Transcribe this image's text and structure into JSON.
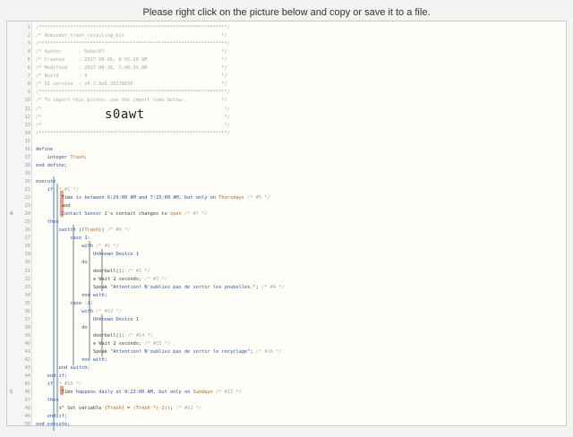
{
  "banner": "Please right click on the picture below and copy or save it to a file.",
  "import_code": "s0awt",
  "lines": [
    {
      "n": "1",
      "t": [
        [
          "/******************************************************************/",
          "cm"
        ]
      ]
    },
    {
      "n": "2",
      "t": [
        [
          "/* Reminder_trash_recycling_bin                                  */",
          "cm"
        ]
      ]
    },
    {
      "n": "3",
      "t": [
        [
          "/******************************************************************/",
          "cm"
        ]
      ]
    },
    {
      "n": "4",
      "t": [
        [
          "/* Author      : Rebel87                                         */",
          "cm"
        ]
      ]
    },
    {
      "n": "5",
      "t": [
        [
          "/* Created     : 2017-08-06, 8:56:28 AM                          */",
          "cm"
        ]
      ]
    },
    {
      "n": "6",
      "t": [
        [
          "/* Modified    : 2017-08-16, 7:48:31 AM                          */",
          "cm"
        ]
      ]
    },
    {
      "n": "7",
      "t": [
        [
          "/* Build       : 9                                               */",
          "cm"
        ]
      ]
    },
    {
      "n": "8",
      "t": [
        [
          "/* UI version  : v0.2.0e6.20170830                               */",
          "cm"
        ]
      ]
    },
    {
      "n": "9",
      "t": [
        [
          "/******************************************************************/",
          "cm"
        ]
      ]
    },
    {
      "n": "10",
      "t": [
        [
          "/* To import this piston, use the import code below:             */",
          "cm"
        ]
      ]
    },
    {
      "n": "11",
      "t": [
        [
          "/*                                                                */",
          "cm"
        ]
      ]
    },
    {
      "n": "12",
      "t": [
        [
          "/*                                                                */",
          "cm"
        ]
      ]
    },
    {
      "n": "13",
      "t": [
        [
          "/*                                                                */",
          "cm"
        ]
      ]
    },
    {
      "n": "14",
      "t": [
        [
          "/******************************************************************/",
          "cm"
        ]
      ]
    },
    {
      "n": "15",
      "t": []
    },
    {
      "n": "16",
      "t": [
        [
          "define",
          "kw"
        ]
      ]
    },
    {
      "n": "17",
      "i": 4,
      "t": [
        [
          "integer ",
          "kw"
        ],
        [
          "Trash",
          "vr"
        ],
        [
          ";",
          ""
        ]
      ]
    },
    {
      "n": "18",
      "t": [
        [
          "end define;",
          "kw"
        ]
      ]
    },
    {
      "n": "19",
      "t": []
    },
    {
      "n": "20",
      "t": [
        [
          "execute",
          "kw"
        ]
      ]
    },
    {
      "n": "21",
      "i": 4,
      "t": [
        [
          "if ",
          "kw"
        ],
        [
          "/* #1 */",
          "cm"
        ]
      ]
    },
    {
      "n": "22",
      "i": 9,
      "t": [
        [
          "Time",
          ""
        ],
        [
          " is between ",
          "kw"
        ],
        [
          "6:29:00 AM",
          "num"
        ],
        [
          " and ",
          "kw"
        ],
        [
          "7:15:00 AM",
          "num"
        ],
        [
          ", but only on ",
          "kw"
        ],
        [
          "Thursdays",
          "vr"
        ],
        [
          " /* #5 */",
          "cm"
        ]
      ]
    },
    {
      "n": "23",
      "i": 9,
      "t": [
        [
          "and",
          ""
        ]
      ]
    },
    {
      "n": "24",
      "m": "4",
      "i": 9,
      "t": [
        [
          "Contact Sensor 2",
          "dev"
        ],
        [
          "'s contact changes to ",
          ""
        ],
        [
          "open",
          "vr"
        ],
        [
          " /* #7 */",
          "cm"
        ]
      ]
    },
    {
      "n": "25",
      "i": 4,
      "t": [
        [
          "then",
          "kw"
        ]
      ]
    },
    {
      "n": "26",
      "i": 8,
      "t": [
        [
          "switch",
          "kw"
        ],
        [
          " ((",
          ""
        ],
        [
          "Trash",
          "vr"
        ],
        [
          ")) ",
          ""
        ],
        [
          "/* #9 */",
          "cm"
        ]
      ]
    },
    {
      "n": "27",
      "i": 12,
      "t": [
        [
          "case 1:",
          "kw"
        ]
      ]
    },
    {
      "n": "28",
      "i": 16,
      "t": [
        [
          "with",
          "kw"
        ],
        [
          " /* #1 */",
          "cm"
        ]
      ]
    },
    {
      "n": "29",
      "i": 20,
      "t": [
        [
          "Unknown Device 1",
          "dev"
        ]
      ]
    },
    {
      "n": "30",
      "i": 16,
      "t": [
        [
          "do",
          "kw"
        ]
      ]
    },
    {
      "n": "31",
      "i": 20,
      "t": [
        [
          "doorbell();",
          ""
        ],
        [
          " /* #2 */",
          "cm"
        ]
      ]
    },
    {
      "n": "32",
      "i": 20,
      "t": [
        [
          "⊙ Wait 2 seconds;",
          ""
        ],
        [
          " /* #3 */",
          "cm"
        ]
      ]
    },
    {
      "n": "33",
      "i": 20,
      "t": [
        [
          "Speak ",
          ""
        ],
        [
          "\"Attention! N'oubliez pas de sortir les poubelles.\"",
          "str"
        ],
        [
          "; ",
          ""
        ],
        [
          "/* #4 */",
          "cm"
        ]
      ]
    },
    {
      "n": "34",
      "i": 16,
      "t": [
        [
          "end with;",
          "kw"
        ]
      ]
    },
    {
      "n": "35",
      "i": 12,
      "t": [
        [
          "case -1:",
          "kw"
        ]
      ]
    },
    {
      "n": "36",
      "i": 16,
      "t": [
        [
          "with",
          "kw"
        ],
        [
          " /* #13 */",
          "cm"
        ]
      ]
    },
    {
      "n": "37",
      "i": 20,
      "t": [
        [
          "Unknown Device 1",
          "dev"
        ]
      ]
    },
    {
      "n": "38",
      "i": 16,
      "t": [
        [
          "do",
          "kw"
        ]
      ]
    },
    {
      "n": "39",
      "i": 20,
      "t": [
        [
          "doorbell();",
          ""
        ],
        [
          " /* #14 */",
          "cm"
        ]
      ]
    },
    {
      "n": "40",
      "i": 20,
      "t": [
        [
          "⊙ Wait 2 seconds;",
          ""
        ],
        [
          " /* #15 */",
          "cm"
        ]
      ]
    },
    {
      "n": "41",
      "i": 20,
      "t": [
        [
          "Speak ",
          ""
        ],
        [
          "\"Attention! N'oubliez pas de sortir le recyclage\"",
          "str"
        ],
        [
          "; ",
          ""
        ],
        [
          "/* #16 */",
          "cm"
        ]
      ]
    },
    {
      "n": "42",
      "i": 16,
      "t": [
        [
          "end with;",
          "kw"
        ]
      ]
    },
    {
      "n": "43",
      "i": 8,
      "t": [
        [
          "end switch;",
          "kw"
        ]
      ]
    },
    {
      "n": "44",
      "i": 4,
      "t": [
        [
          "end if;",
          "kw"
        ]
      ]
    },
    {
      "n": "45",
      "i": 4,
      "t": [
        [
          "if ",
          "kw"
        ],
        [
          "/* #10 */",
          "cm"
        ]
      ]
    },
    {
      "n": "46",
      "m": "5",
      "i": 9,
      "t": [
        [
          "Time",
          ""
        ],
        [
          " happens daily at ",
          "kw"
        ],
        [
          "9:23:00 AM",
          "num"
        ],
        [
          ", but only on ",
          "kw"
        ],
        [
          "Sundays",
          "vr"
        ],
        [
          " /* #12 */",
          "cm"
        ]
      ]
    },
    {
      "n": "47",
      "i": 4,
      "t": [
        [
          "then",
          "kw"
        ]
      ]
    },
    {
      "n": "48",
      "i": 8,
      "t": [
        [
          "x² Set variable ",
          ""
        ],
        [
          "{Trash}",
          "vr"
        ],
        [
          " = ",
          ""
        ],
        [
          "(Trash *(-1))",
          "vr"
        ],
        [
          ";",
          ""
        ],
        [
          " /* #11 */",
          "cm"
        ]
      ]
    },
    {
      "n": "49",
      "i": 4,
      "t": [
        [
          "end if;",
          "kw"
        ]
      ]
    },
    {
      "n": "50",
      "t": [
        [
          "end execute;",
          "kw"
        ]
      ]
    }
  ]
}
